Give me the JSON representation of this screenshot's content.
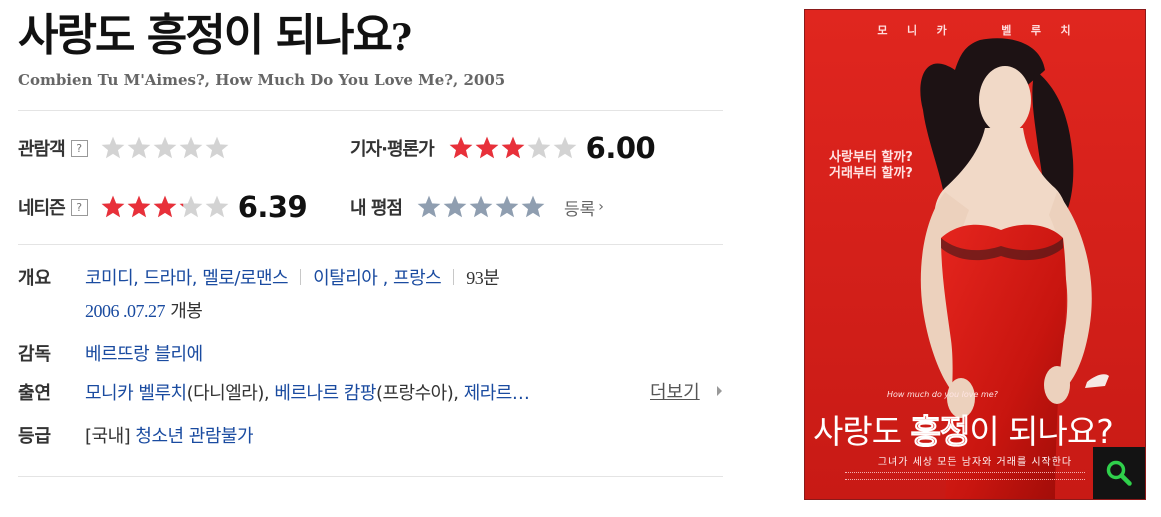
{
  "title": {
    "main": "사랑도 흥정이 되나요",
    "qmark": "?"
  },
  "subtitle": "Combien Tu M'Aimes?, How Much Do You Love Me?, 2005",
  "ratings": {
    "audience": {
      "label": "관람객",
      "help": "?",
      "stars_filled": 0,
      "score": ""
    },
    "critics": {
      "label": "기자·평론가",
      "stars_filled": 3,
      "score": "6.00"
    },
    "netizen": {
      "label": "네티즌",
      "help": "?",
      "stars_filled": 3.2,
      "score": "6.39"
    },
    "mine": {
      "label": "내 평점",
      "stars_filled": 0,
      "register": "등록"
    }
  },
  "info": {
    "overview_label": "개요",
    "genres": "코미디, 드라마, 멜로/로맨스",
    "countries": "이탈리아 , 프랑스",
    "runtime": "93분",
    "release_date": "2006 .07.27",
    "release_suffix": " 개봉",
    "director_label": "감독",
    "director": "베르뜨랑 블리에",
    "cast_label": "출연",
    "cast": [
      {
        "name": "모니카 벨루치",
        "role": "(다니엘라)"
      },
      {
        "name": "베르나르 캄팡",
        "role": "(프랑수아)"
      },
      {
        "name": "제라르…",
        "role": ""
      }
    ],
    "more": "더보기",
    "grade_label": "등급",
    "grade_prefix": "[국내]",
    "grade": " 청소년 관람불가"
  },
  "poster": {
    "names": "모   니   카         벨   루   치",
    "tagline": "사랑부터 할까?\n거래부터 할까?",
    "small": "How much do you love me?",
    "title_a": "사랑도 ",
    "title_b": "흥정",
    "title_c": "이 되나요?",
    "subline": "그녀가 세상 모든 남자와 거래를 시작한다",
    "zoom_icon": "search-icon"
  },
  "colors": {
    "star_red": "#e8303a",
    "star_gray": "#d3d3d3",
    "star_blue_gray": "#8f9eb0",
    "link_blue": "#1a4ba0",
    "poster_red": "#d9221c",
    "zoom_green": "#2fd04b"
  }
}
